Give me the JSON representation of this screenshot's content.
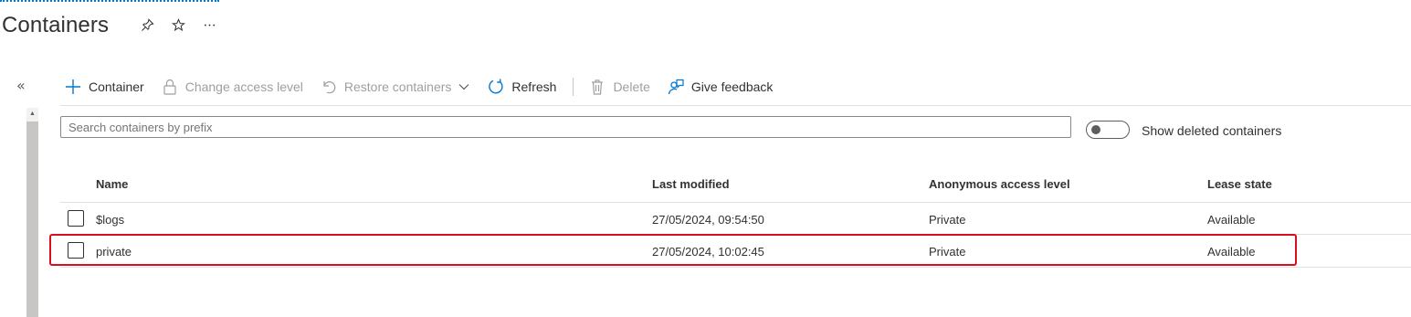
{
  "page": {
    "title": "Containers",
    "title_actions": [
      "pin-icon",
      "star-icon",
      "more-icon"
    ]
  },
  "toolbar": {
    "container_label": "Container",
    "change_access_label": "Change access level",
    "restore_label": "Restore containers",
    "refresh_label": "Refresh",
    "delete_label": "Delete",
    "feedback_label": "Give feedback"
  },
  "search": {
    "placeholder": "Search containers by prefix",
    "value": ""
  },
  "toggle": {
    "label": "Show deleted containers",
    "checked": false
  },
  "table": {
    "columns": [
      "Name",
      "Last modified",
      "Anonymous access level",
      "Lease state"
    ],
    "rows": [
      {
        "name": "$logs",
        "last_modified": "27/05/2024, 09:54:50",
        "access": "Private",
        "lease": "Available"
      },
      {
        "name": "private",
        "last_modified": "27/05/2024, 10:02:45",
        "access": "Private",
        "lease": "Available"
      }
    ]
  },
  "colors": {
    "accent": "#0078d4",
    "highlight": "#d70f1f",
    "text": "#323130",
    "disabled": "#a19f9d"
  }
}
